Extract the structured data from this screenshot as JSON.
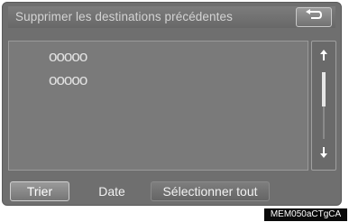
{
  "header": {
    "title": "Supprimer les destinations précédentes",
    "back_icon": "return-arrow-icon"
  },
  "list": {
    "items": [
      {
        "label": "ooooo"
      },
      {
        "label": "ooooo"
      }
    ]
  },
  "scrollbar": {
    "up_icon": "scroll-up-arrow-icon",
    "down_icon": "scroll-down-arrow-icon"
  },
  "bottom_bar": {
    "sort_label": "Trier",
    "date_label": "Date",
    "select_all_label": "Sélectionner tout"
  },
  "watermark": "MEM050aCTgCA"
}
